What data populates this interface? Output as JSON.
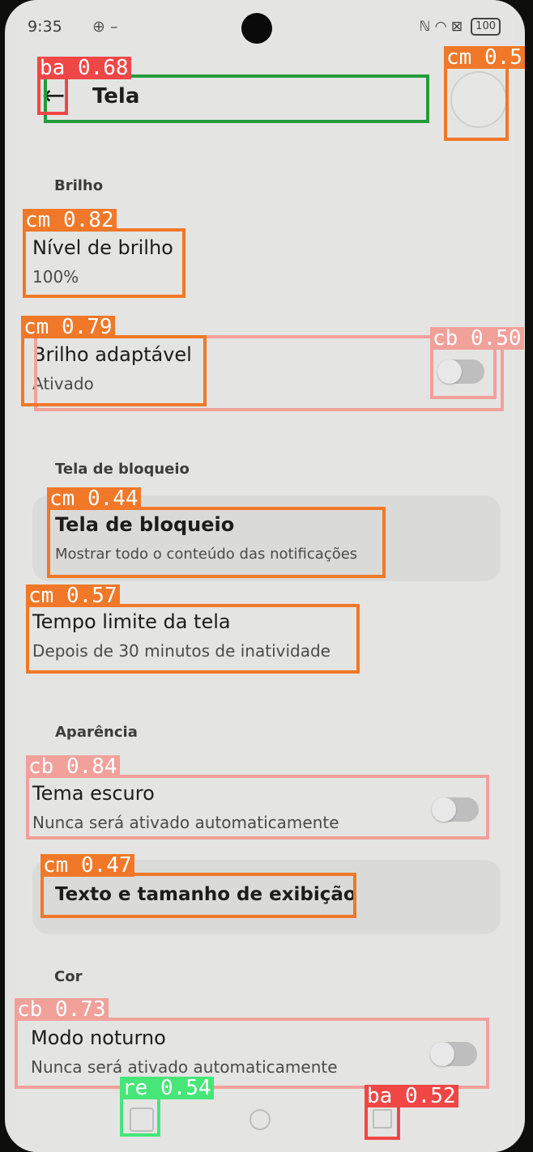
{
  "status_bar": {
    "time": "9:35",
    "left_icons": "⊕ –",
    "right_icons": "ℕ ◠ ⊠",
    "battery": "100"
  },
  "header": {
    "title": "Tela"
  },
  "sections": {
    "brilho": "Brilho",
    "bloqueio": "Tela de bloqueio",
    "aparencia": "Aparência",
    "cor": "Cor"
  },
  "items": {
    "nivel_brilho": {
      "title": "Nível de brilho",
      "subtitle": "100%"
    },
    "brilho_adaptavel": {
      "title": "Brilho adaptável",
      "subtitle": "Ativado",
      "toggle_on": false
    },
    "tela_bloqueio": {
      "title": "Tela de bloqueio",
      "subtitle": "Mostrar todo o conteúdo das notificações"
    },
    "tempo_limite": {
      "title": "Tempo limite da tela",
      "subtitle": "Depois de 30 minutos de inatividade"
    },
    "tema_escuro": {
      "title": "Tema escuro",
      "subtitle": "Nunca será ativado automaticamente",
      "toggle_on": false
    },
    "texto_tamanho": {
      "title": "Texto e tamanho de exibição"
    },
    "modo_noturno": {
      "title": "Modo noturno",
      "subtitle": "Nunca será ativado automaticamente",
      "toggle_on": false
    }
  },
  "detections": {
    "back": "ba 0.68",
    "avatar": "cm 0.5",
    "nivel": "cm 0.82",
    "brilho_adapt_label": "cm 0.79",
    "brilho_adapt_toggle": "cb 0.50",
    "bloqueio": "cm 0.44",
    "tempo": "cm 0.57",
    "tema": "cb 0.84",
    "texto": "cm 0.47",
    "noturno": "cb 0.73",
    "nav_recent": "re 0.54",
    "nav_back": "ba 0.52"
  },
  "colors": {
    "orange": "#f07828",
    "salmon": "#f2a09a",
    "red": "#f04646",
    "green_header": "#239b3c",
    "green_nav": "#46e678"
  }
}
